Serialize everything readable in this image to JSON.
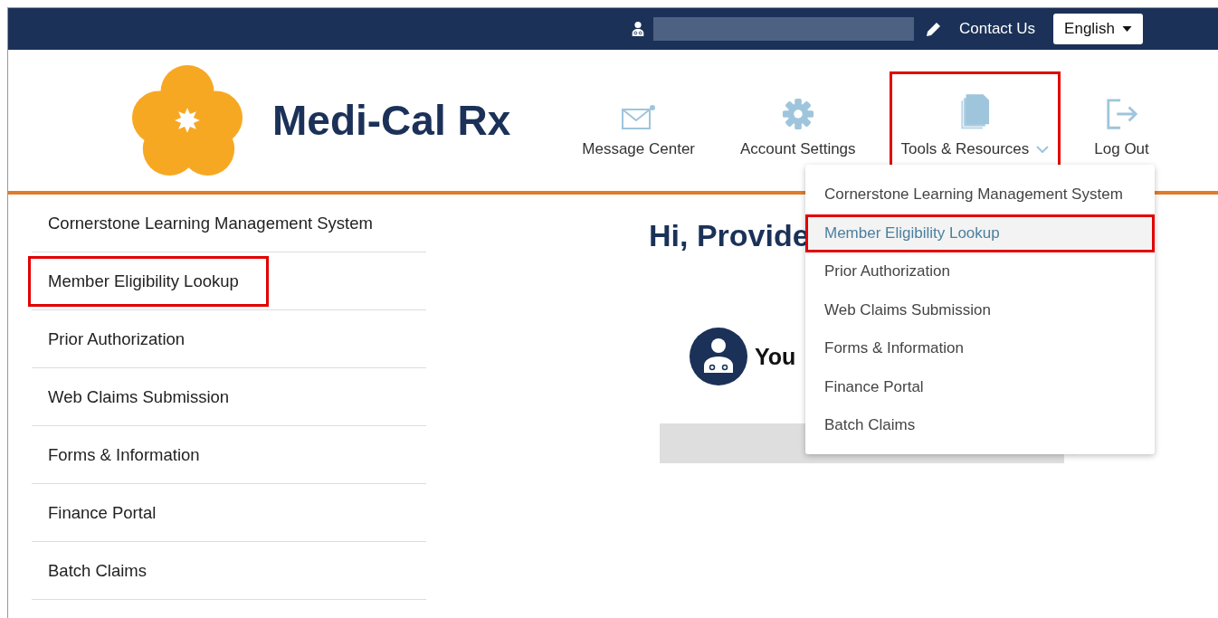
{
  "top_bar": {
    "contact_link": "Contact Us",
    "language": "English"
  },
  "header": {
    "brand": "Medi-Cal Rx",
    "nav": [
      {
        "kind": "mail",
        "label": "Message Center",
        "annotated": false,
        "expanded": false
      },
      {
        "kind": "gear",
        "label": "Account Settings",
        "annotated": false,
        "expanded": false
      },
      {
        "kind": "documents",
        "label": "Tools & Resources",
        "annotated": true,
        "expanded": true
      },
      {
        "kind": "logout",
        "label": "Log Out",
        "annotated": false,
        "expanded": false
      }
    ]
  },
  "dropdown": [
    {
      "label": "Cornerstone Learning Management System",
      "selected": false,
      "annotated": false
    },
    {
      "label": "Member Eligibility Lookup",
      "selected": true,
      "annotated": true
    },
    {
      "label": "Prior Authorization",
      "selected": false,
      "annotated": false
    },
    {
      "label": "Web Claims Submission",
      "selected": false,
      "annotated": false
    },
    {
      "label": "Forms & Information",
      "selected": false,
      "annotated": false
    },
    {
      "label": "Finance Portal",
      "selected": false,
      "annotated": false
    },
    {
      "label": "Batch Claims",
      "selected": false,
      "annotated": false
    }
  ],
  "sidebar": [
    {
      "label": "Cornerstone Learning Management System",
      "annotated": false
    },
    {
      "label": "Member Eligibility Lookup",
      "annotated": true
    },
    {
      "label": "Prior Authorization",
      "annotated": false
    },
    {
      "label": "Web Claims Submission",
      "annotated": false
    },
    {
      "label": "Forms & Information",
      "annotated": false
    },
    {
      "label": "Finance Portal",
      "annotated": false
    },
    {
      "label": "Batch Claims",
      "annotated": false
    }
  ],
  "main": {
    "greeting": "Hi, Provide",
    "role_text": "You"
  }
}
